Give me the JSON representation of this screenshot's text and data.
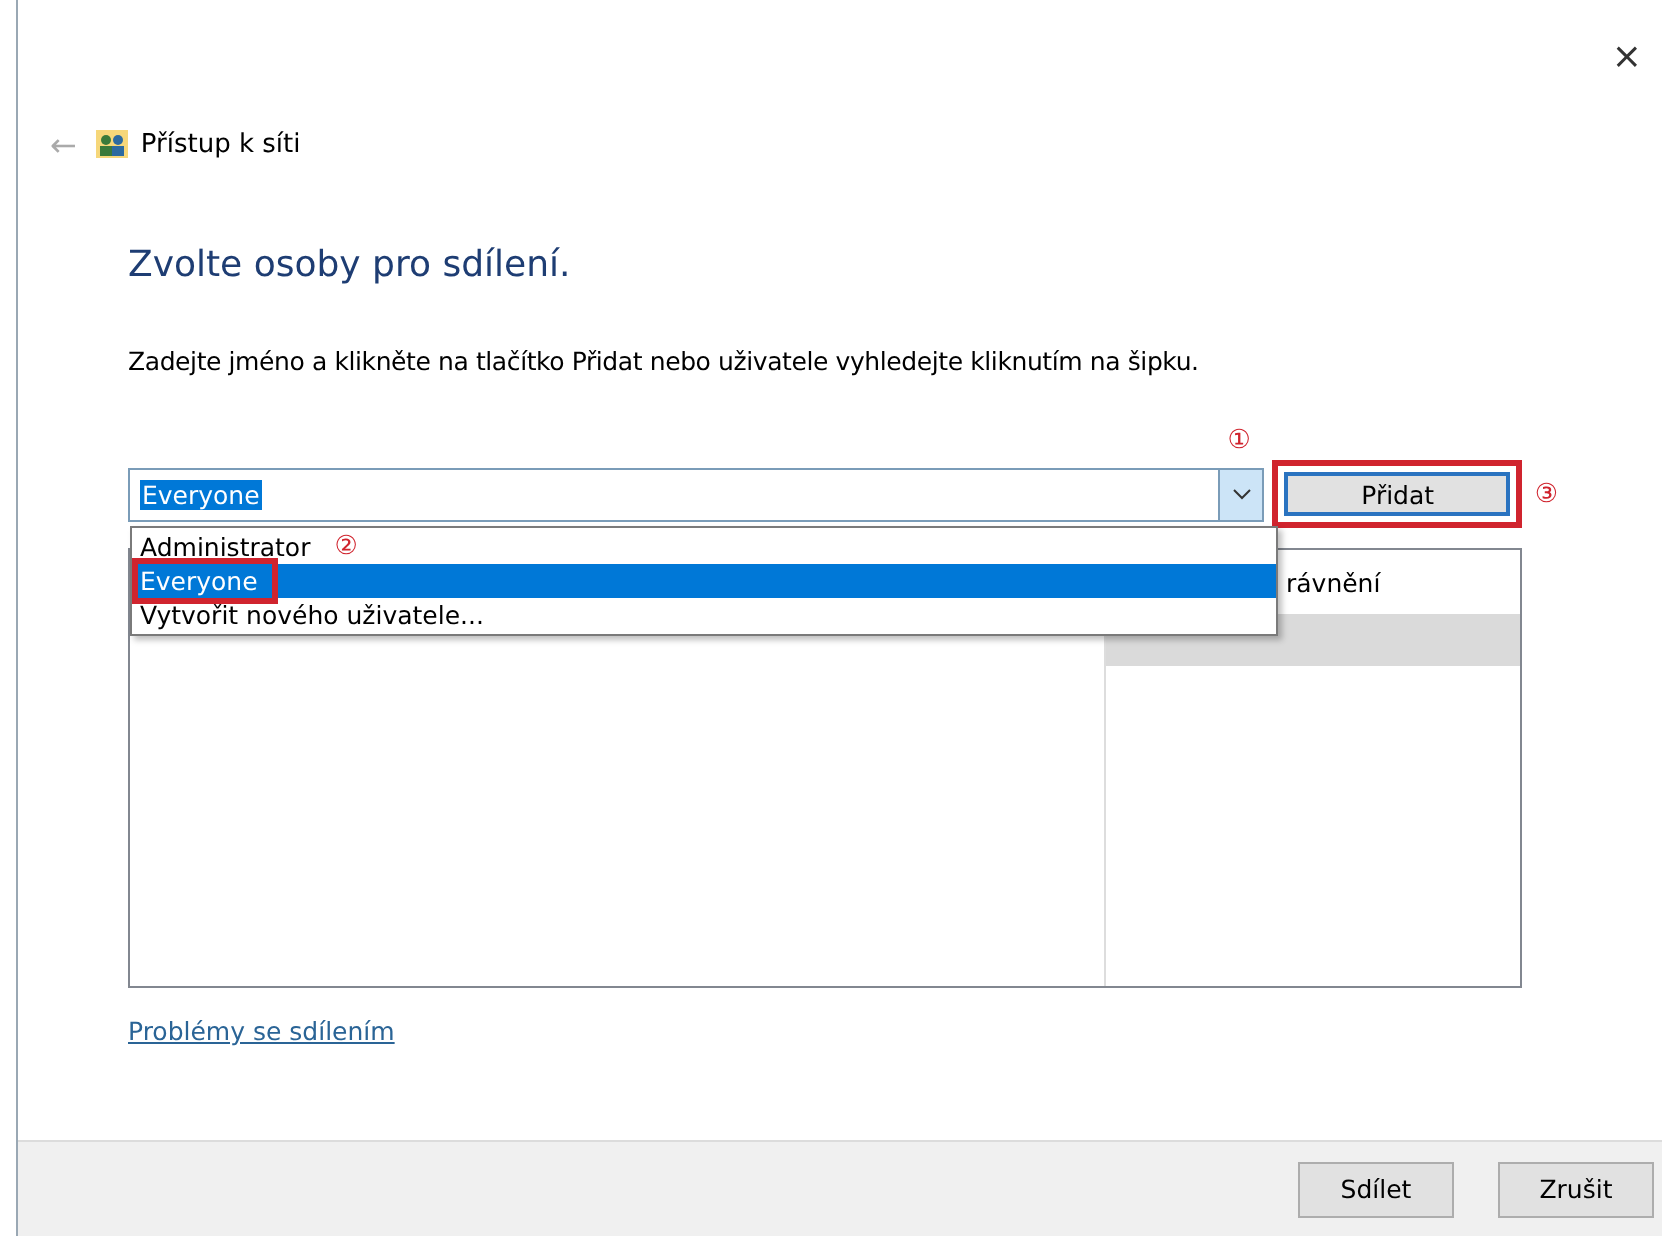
{
  "window": {
    "title": "Přístup k síti",
    "close": "×",
    "back": "←"
  },
  "heading": "Zvolte osoby pro sdílení.",
  "instruction": "Zadejte jméno a klikněte na tlačítko Přidat nebo uživatele vyhledejte kliknutím na šipku.",
  "combo": {
    "value": "Everyone",
    "expanded": true,
    "marker": "①"
  },
  "dropdown_items": [
    {
      "label": "Administrator",
      "selected": false,
      "highlighted_box": false,
      "marker": "②"
    },
    {
      "label": "Everyone",
      "selected": true,
      "highlighted_box": true
    },
    {
      "label": "Vytvořit nového uživatele...",
      "selected": false,
      "highlighted_box": false
    }
  ],
  "add_button": {
    "label": "Přidat",
    "highlighted_box": true,
    "marker": "③"
  },
  "table": {
    "columns": [
      "rávnění"
    ],
    "rows": [
      {
        "selected": true
      }
    ]
  },
  "link": "Problémy se sdílením",
  "buttons": [
    "Sdílet",
    "Zrušit"
  ]
}
